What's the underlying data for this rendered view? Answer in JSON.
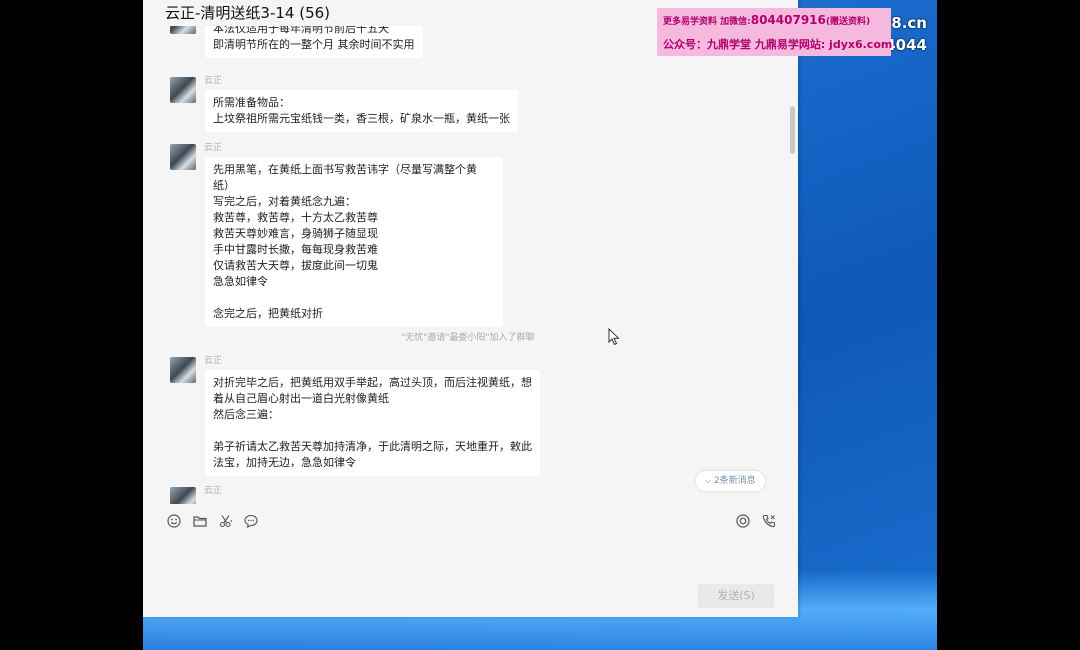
{
  "window": {
    "title": "云正-清明送纸3-14 (56)"
  },
  "desktop": {
    "text_line1": "8.cn",
    "text_line2": "4044"
  },
  "watermark": {
    "line1_prefix": "更多易学资料 加微信:",
    "line1_number": "804407916",
    "line1_suffix": "(赠送资料)",
    "line2": "公众号：九鼎学堂 九鼎易学网站: jdyx6.com"
  },
  "messages": [
    {
      "sender": "",
      "text": "本法仅适用于每年清明节前后十五天\n即清明节所在的一整个月 其余时间不实用"
    },
    {
      "sender": "云正",
      "text": "所需准备物品：\n上坟祭祖所需元宝纸钱一类，香三根，矿泉水一瓶，黄纸一张"
    },
    {
      "sender": "云正",
      "text": "先用黑笔，在黄纸上面书写救苦讳字（尽量写满整个黄纸）\n写完之后，对着黄纸念九遍：\n救苦尊，救苦尊，十方太乙救苦尊\n救苦天尊妙难言，身骑狮子随显现\n手中甘露时长撒，每每现身救苦难\n仅请救苦大天尊，拔度此间一切鬼\n急急如律令\n\n念完之后，把黄纸对折"
    },
    {
      "sender": "云正",
      "text": "对折完毕之后，把黄纸用双手举起，高过头顶，而后注视黄纸，想\n着从自己眉心射出一道白光射像黄纸\n然后念三遍：\n\n弟子祈请太乙救苦天尊加持清净，于此清明之际，天地重开，敕此\n法宝，加持无边，急急如律令"
    },
    {
      "sender": "云正",
      "text": ""
    }
  ],
  "system_note": "\"无忧\"邀请\"最委小阳\"加入了群聊",
  "new_messages_pill": "2条新消息",
  "send_button": "发送(S)",
  "icons": [
    "emoji-icon",
    "folder-icon",
    "scissors-icon",
    "chat-bubble-icon",
    "video-call-icon",
    "phone-icon"
  ],
  "colors": {
    "window_bg": "#f5f5f5",
    "bubble_bg": "#ffffff",
    "watermark_bg": "#f4b9dd",
    "watermark_text": "#b1006e",
    "desktop_blue": "#1667c9"
  }
}
